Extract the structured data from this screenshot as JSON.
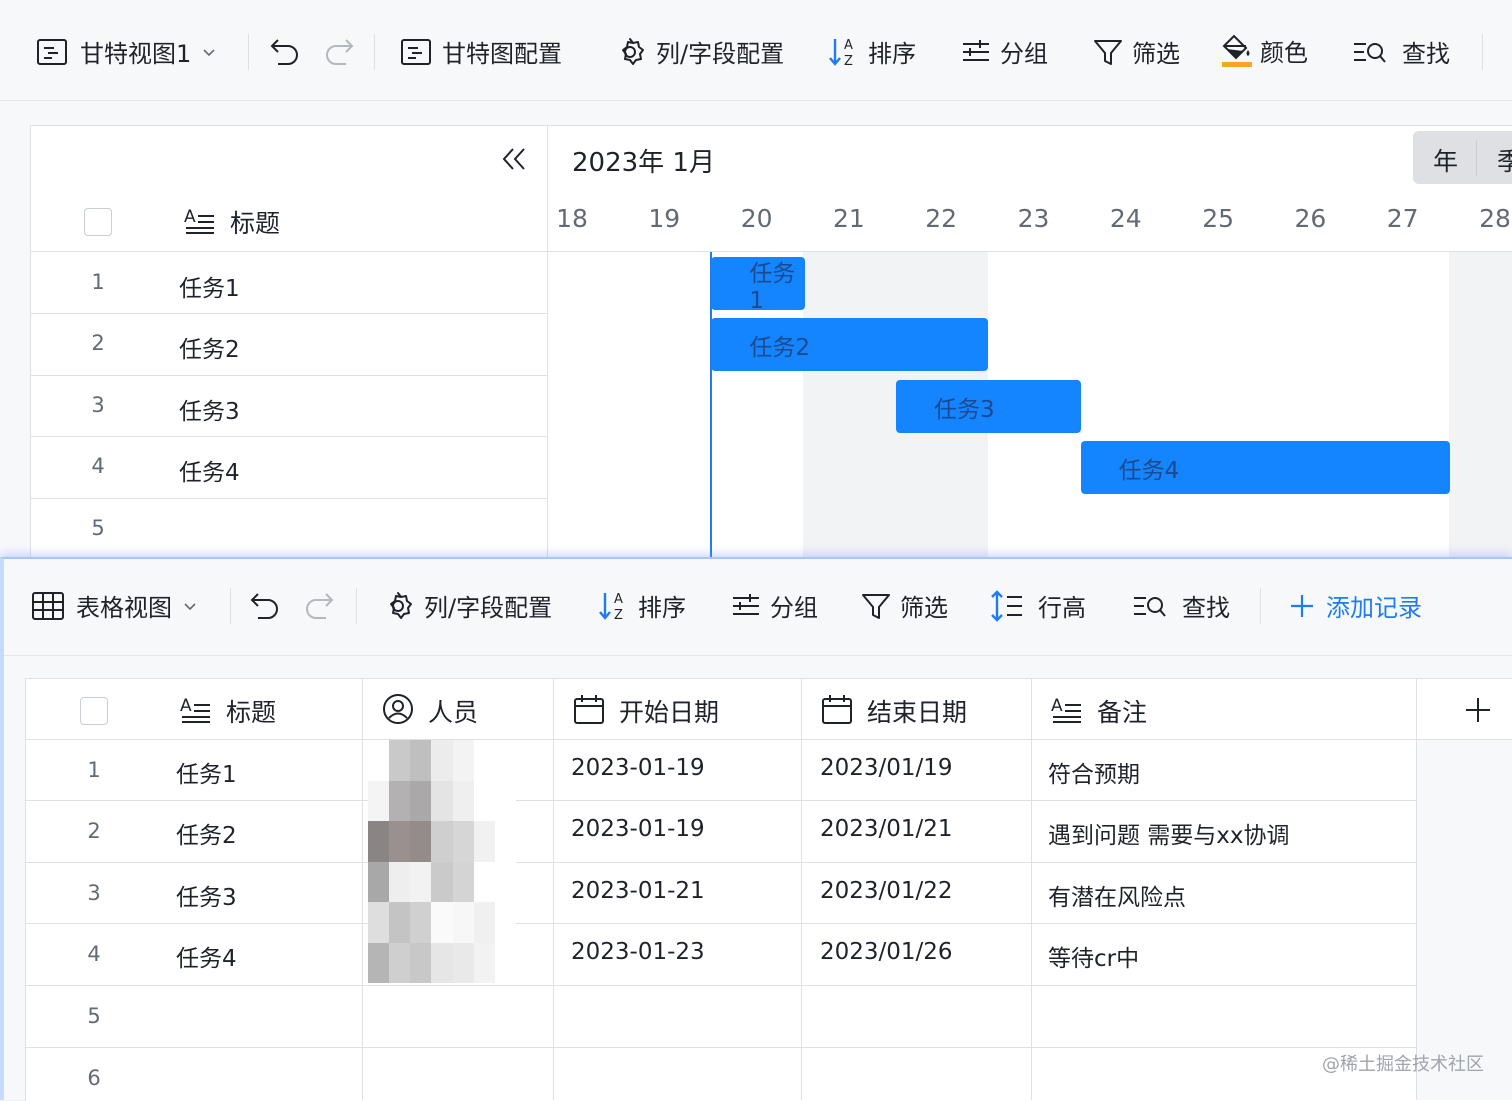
{
  "gantt_toolbar": {
    "view_name": "甘特视图1",
    "gantt_config": "甘特图配置",
    "column_config": "列/字段配置",
    "sort": "排序",
    "group": "分组",
    "filter": "筛选",
    "color": "颜色",
    "find": "查找"
  },
  "gantt": {
    "month_label": "2023年 1月",
    "scale_year": "年",
    "scale_quarter": "季",
    "title_header": "标题",
    "days": [
      "18",
      "19",
      "20",
      "21",
      "22",
      "23",
      "24",
      "25",
      "26",
      "27",
      "28"
    ],
    "rows": [
      {
        "num": "1",
        "title": "任务1"
      },
      {
        "num": "2",
        "title": "任务2"
      },
      {
        "num": "3",
        "title": "任务3"
      },
      {
        "num": "4",
        "title": "任务4"
      },
      {
        "num": "5",
        "title": ""
      }
    ],
    "bars": [
      {
        "label": "任务1",
        "start": 19,
        "end": 20
      },
      {
        "label": "任务2",
        "start": 19,
        "end": 22
      },
      {
        "label": "任务3",
        "start": 21,
        "end": 23
      },
      {
        "label": "任务4",
        "start": 23,
        "end": 27
      }
    ]
  },
  "table_toolbar": {
    "view_name": "表格视图",
    "column_config": "列/字段配置",
    "sort": "排序",
    "group": "分组",
    "filter": "筛选",
    "row_height": "行高",
    "find": "查找",
    "add_record": "添加记录"
  },
  "table": {
    "headers": {
      "title": "标题",
      "person": "人员",
      "start": "开始日期",
      "end": "结束日期",
      "note": "备注"
    },
    "rows": [
      {
        "num": "1",
        "title": "任务1",
        "start": "2023-01-19",
        "end": "2023/01/19",
        "note": "符合预期"
      },
      {
        "num": "2",
        "title": "任务2",
        "start": "2023-01-19",
        "end": "2023/01/21",
        "note": "遇到问题 需要与xx协调"
      },
      {
        "num": "3",
        "title": "任务3",
        "start": "2023-01-21",
        "end": "2023/01/22",
        "note": "有潜在风险点"
      },
      {
        "num": "4",
        "title": "任务4",
        "start": "2023-01-23",
        "end": "2023/01/26",
        "note": "等待cr中"
      },
      {
        "num": "5",
        "title": "",
        "start": "",
        "end": "",
        "note": ""
      },
      {
        "num": "6",
        "title": "",
        "start": "",
        "end": "",
        "note": ""
      }
    ]
  },
  "watermark": "@稀土掘金技术社区",
  "colors": {
    "accent": "#1584ff",
    "link": "#1f7cf0"
  }
}
